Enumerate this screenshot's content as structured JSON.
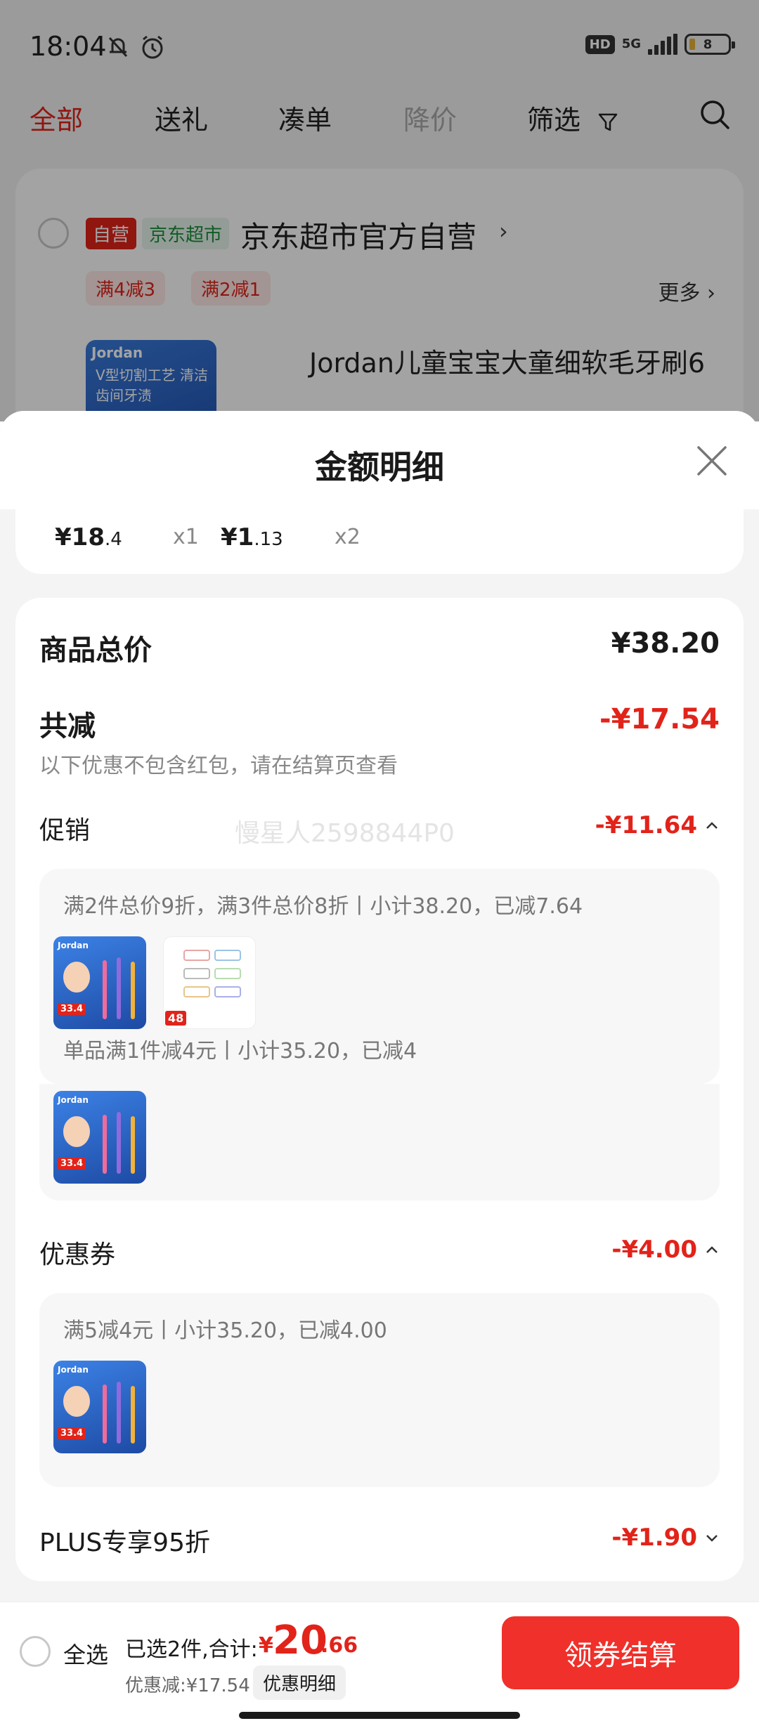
{
  "status_bar": {
    "time": "18:04",
    "hd": "HD",
    "network": "5G",
    "battery": "8"
  },
  "tabs": [
    "全部",
    "送礼",
    "凑单",
    "降价",
    "筛选"
  ],
  "store": {
    "self_tag": "自营",
    "market_tag": "京东超市",
    "name": "京东超市官方自营",
    "promos": [
      "满4减3",
      "满2减1"
    ],
    "more": "更多",
    "product_title": "Jordan儿童宝宝大童细软毛牙刷6",
    "thumb_brand": "Jordan",
    "thumb_slogan": "V型切割工艺 清洁齿间牙渍"
  },
  "sheet": {
    "title": "金额明细",
    "items": [
      {
        "price_int": "¥18",
        "price_dec": ".4",
        "qty": "x1"
      },
      {
        "price_int": "¥1",
        "price_dec": ".13",
        "qty": "x2"
      }
    ],
    "total_label": "商品总价",
    "total_value": "¥38.20",
    "discount_label": "共减",
    "discount_value": "-¥17.54",
    "discount_note": "以下优惠不包含红包，请在结算页查看",
    "watermark": "慢星人2598844P0",
    "promotion": {
      "label": "促销",
      "value": "-¥11.64",
      "rules": [
        "满2件总价9折，满3件总价8折丨小计38.20，已减7.64",
        "单品满1件减4元丨小计35.20，已减4"
      ]
    },
    "coupon": {
      "label": "优惠券",
      "value": "-¥4.00",
      "rules": [
        "满5减4元丨小计35.20，已减4.00"
      ]
    },
    "plus": {
      "label": "PLUS专享95折",
      "value": "-¥1.90"
    },
    "thumb_badge": "33.4",
    "clip_badge": "48"
  },
  "bottom_bar": {
    "select_all": "全选",
    "selected_label": "已选2件,合计:",
    "yen": "¥",
    "total_int": "20",
    "total_dec": ".66",
    "discount_label": "优惠减:¥17.54",
    "detail_button": "优惠明细",
    "checkout_button": "领券结算"
  },
  "colors": {
    "accent_red": "#e2231a",
    "checkout_red": "#f0302a",
    "market_green": "#1c8f3a"
  }
}
